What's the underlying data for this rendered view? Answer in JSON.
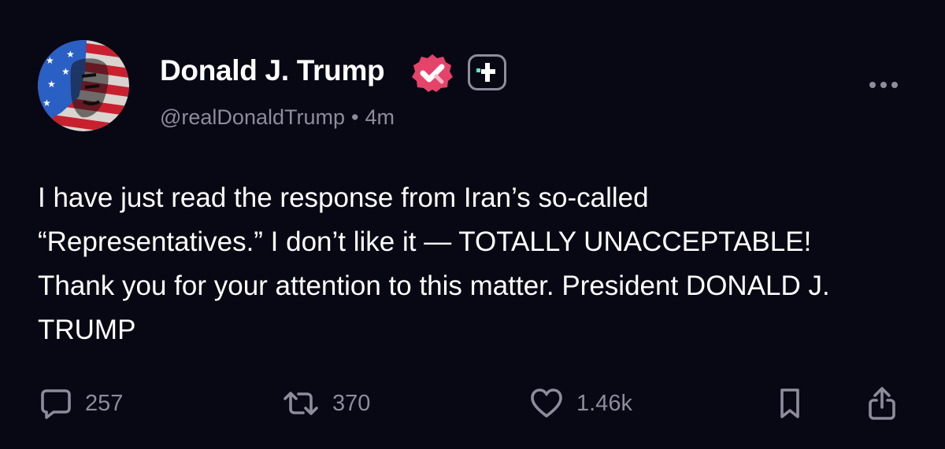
{
  "post": {
    "author": {
      "display_name": "Donald J. Trump",
      "handle": "@realDonaldTrump",
      "verified": true
    },
    "separator": "•",
    "time_ago": "4m",
    "body": "I have just read the response from Iran’s so-called “Representatives.” I don’t like it — TOTALLY UNACCEPTABLE! Thank you for your attention to this matter. President DONALD J. TRUMP",
    "actions": {
      "replies": "257",
      "reposts": "370",
      "likes": "1.46k"
    }
  },
  "colors": {
    "background": "#080714",
    "text_primary": "#ffffff",
    "text_secondary": "#8e8c9c",
    "verified_badge": "#e5436a",
    "accent_teal": "#5fe3cd"
  },
  "icons": {
    "avatar": "flag-face-avatar",
    "verified": "verified-badge-icon",
    "platform": "plus-badge-icon",
    "more": "more-options-icon",
    "reply": "speech-bubble-icon",
    "repost": "repost-arrows-icon",
    "like": "heart-icon",
    "bookmark": "bookmark-icon",
    "share": "share-icon"
  }
}
